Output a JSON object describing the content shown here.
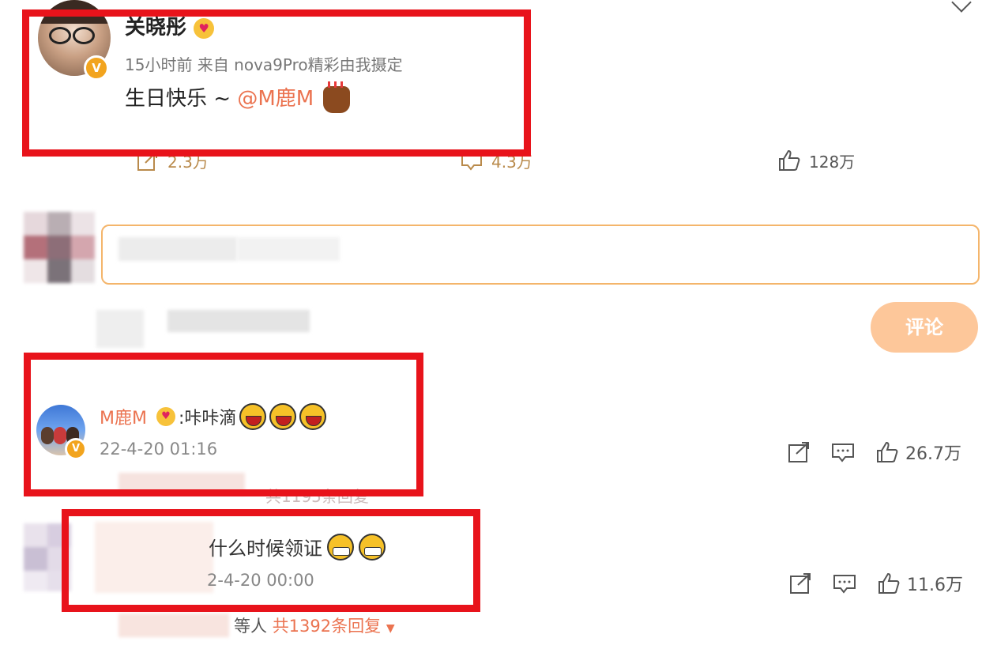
{
  "post": {
    "author": "关晓彤",
    "meta": "15小时前  来自 nova9Pro精彩由我摄定",
    "text_prefix": "生日快乐 ~ ",
    "mention": "@M鹿M",
    "shares": "2.3万",
    "comments": "4.3万",
    "likes": "128万"
  },
  "composer": {
    "submit_label": "评论"
  },
  "comments": [
    {
      "author": "M鹿M",
      "text": ":咔咔滴",
      "time": "22-4-20 01:16",
      "likes": "26.7万",
      "faded_replies": "共1195条回复"
    },
    {
      "text": "什么时候领证",
      "time": "2-4-20 00:00",
      "likes": "11.6万",
      "replies_prefix": "等人 ",
      "replies_count": "共1392条回复"
    }
  ],
  "colors": {
    "accent": "#eb7350",
    "highlight": "#e8131b",
    "button": "#fdc79a",
    "input_border": "#f4b56b"
  }
}
